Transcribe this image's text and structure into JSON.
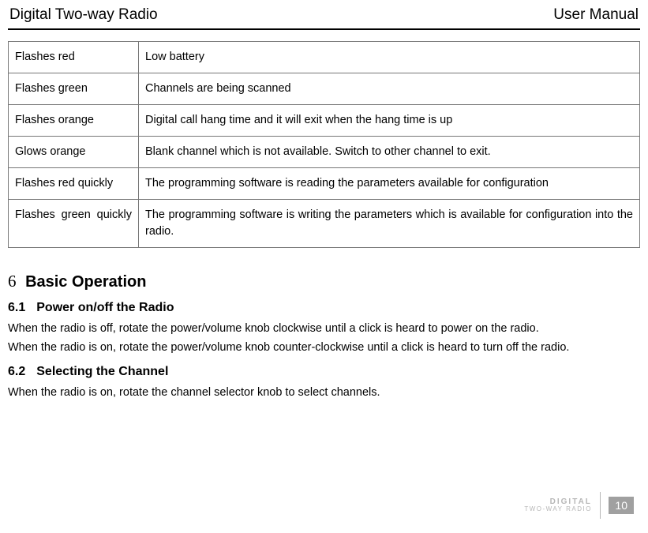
{
  "header": {
    "left": "Digital Two-way Radio",
    "right": "User Manual"
  },
  "table": {
    "rows": [
      {
        "c1": "Flashes red",
        "c2": "Low battery",
        "justify": false
      },
      {
        "c1": "Flashes green",
        "c2": "Channels are being scanned",
        "justify": false
      },
      {
        "c1": "Flashes orange",
        "c2": "Digital call hang time and it will exit when the hang time is up",
        "justify": false
      },
      {
        "c1": "Glows orange",
        "c2": "Blank channel which is not available. Switch to other channel to exit.",
        "justify": false
      },
      {
        "c1": "Flashes red quickly",
        "c2": "The programming software is reading the parameters available for configuration",
        "justify": false
      },
      {
        "c1": "Flashes green quickly",
        "c2": "The programming software is writing the parameters which is available for configuration into the radio.",
        "justify": true
      }
    ]
  },
  "section": {
    "number": "6",
    "title": "Basic Operation",
    "subsections": [
      {
        "number": "6.1",
        "title": "Power on/off the Radio",
        "paragraphs": [
          "When the radio is off, rotate the power/volume knob clockwise until a click is heard to power on the radio.",
          "When the radio is on, rotate the power/volume knob counter-clockwise until a click is heard to turn off the radio."
        ]
      },
      {
        "number": "6.2",
        "title": "Selecting the Channel",
        "paragraphs": [
          "When the radio is on, rotate the channel selector knob to select channels."
        ]
      }
    ]
  },
  "footer": {
    "logo_line1": "DIGITAL",
    "logo_line2": "TWO-WAY RADIO",
    "page": "10"
  }
}
